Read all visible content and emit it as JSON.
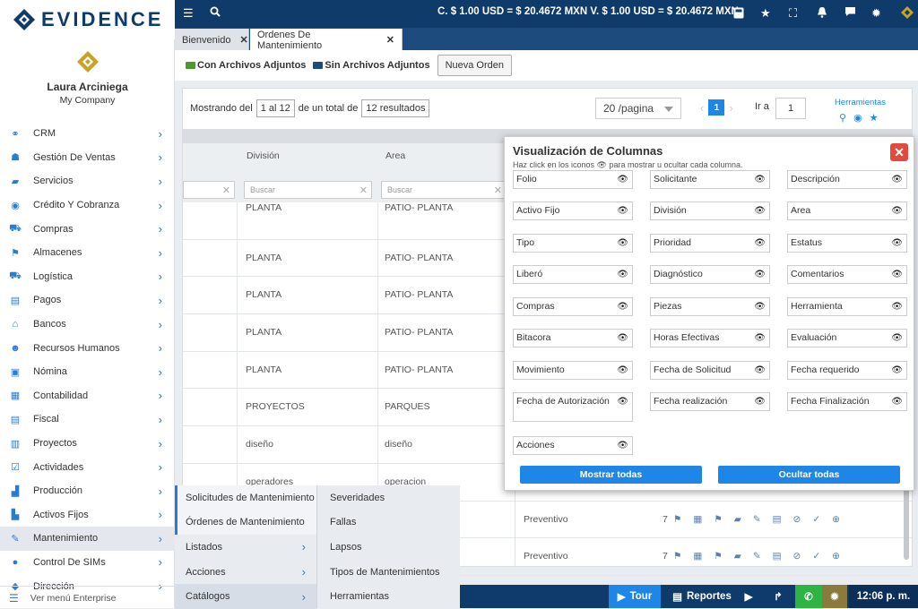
{
  "brand": {
    "name": "EVIDENCE"
  },
  "topbar": {
    "rates": "C. $ 1.00 USD = $ 20.4672 MXN   V. $ 1.00 USD = $ 20.4672 MXN",
    "icons": [
      "menu-icon",
      "search-icon",
      "calculator-icon",
      "star-icon",
      "fullscreen-icon",
      "bell-icon",
      "chat-icon",
      "gear-icon",
      "logo-icon"
    ]
  },
  "user": {
    "name": "Laura Arciniega",
    "company": "My Company"
  },
  "menu": [
    {
      "label": "CRM",
      "icon": "crm-icon",
      "glyph": "⚭"
    },
    {
      "label": "Gestión De Ventas",
      "icon": "sales-icon",
      "glyph": "☗"
    },
    {
      "label": "Servicios",
      "icon": "services-icon",
      "glyph": "▰"
    },
    {
      "label": "Crédito Y Cobranza",
      "icon": "credit-icon",
      "glyph": "◉"
    },
    {
      "label": "Compras",
      "icon": "cart-icon",
      "glyph": "⛟"
    },
    {
      "label": "Almacenes",
      "icon": "warehouse-icon",
      "glyph": "⚑"
    },
    {
      "label": "Logística",
      "icon": "truck-icon",
      "glyph": "⛟"
    },
    {
      "label": "Pagos",
      "icon": "payments-icon",
      "glyph": "▤"
    },
    {
      "label": "Bancos",
      "icon": "bank-icon",
      "glyph": "⌂"
    },
    {
      "label": "Recursos Humanos",
      "icon": "people-icon",
      "glyph": "☻"
    },
    {
      "label": "Nómina",
      "icon": "payroll-icon",
      "glyph": "▣"
    },
    {
      "label": "Contabilidad",
      "icon": "calculator-icon",
      "glyph": "▦"
    },
    {
      "label": "Fiscal",
      "icon": "fiscal-icon",
      "glyph": "▤"
    },
    {
      "label": "Proyectos",
      "icon": "chart-icon",
      "glyph": "▥"
    },
    {
      "label": "Actividades",
      "icon": "check-icon",
      "glyph": "☑"
    },
    {
      "label": "Producción",
      "icon": "production-icon",
      "glyph": "▟"
    },
    {
      "label": "Activos Fijos",
      "icon": "assets-icon",
      "glyph": "▙"
    },
    {
      "label": "Mantenimiento",
      "icon": "wrench-icon",
      "glyph": "✎"
    },
    {
      "label": "Control De SIMs",
      "icon": "location-icon",
      "glyph": "●"
    },
    {
      "label": "Dirección",
      "icon": "direction-icon",
      "glyph": "◆"
    }
  ],
  "enterprise_link": "Ver menú Enterprise",
  "tabs": [
    {
      "label": "Bienvenido"
    },
    {
      "label": "Ordenes De Mantenimiento"
    }
  ],
  "filterbar": {
    "with_attachments": "Con Archivos Adjuntos",
    "without_attachments": "Sin Archivos Adjuntos",
    "new_order": "Nueva Orden",
    "colors": {
      "green_folder": "#4a9a2e",
      "blue_folder": "#1e4b7e"
    }
  },
  "paging": {
    "showing": "Mostrando del",
    "range": "1 al 12",
    "of_total": "de un total de",
    "total": "12 resultados",
    "per_page": "20 /pagina",
    "current_page": "1",
    "go_to": "Ir a",
    "go_value": "1",
    "tools": "Herramientas"
  },
  "table": {
    "headers": [
      "División",
      "Area"
    ],
    "search_placeholder": "Buscar",
    "rows": [
      {
        "division": "PLANTA",
        "area": "PATIO- PLANTA"
      },
      {
        "division": "PLANTA",
        "area": "PATIO- PLANTA"
      },
      {
        "division": "PLANTA",
        "area": "PATIO- PLANTA"
      },
      {
        "division": "PLANTA",
        "area": "PATIO- PLANTA"
      },
      {
        "division": "PLANTA",
        "area": "PATIO- PLANTA"
      },
      {
        "division": "PROYECTOS",
        "area": "PARQUES"
      },
      {
        "division": "diseño",
        "area": "diseño"
      },
      {
        "division": "operadores",
        "area": "operacion"
      }
    ],
    "preventivo_rows": [
      {
        "tipo": "Preventivo",
        "num": "7"
      },
      {
        "tipo": "Preventivo",
        "num": "7"
      }
    ]
  },
  "columns_popup": {
    "title": "Visualización de Columnas",
    "subtitle": "Haz click en los iconos 👁 para mostrar u ocultar cada columna.",
    "columns": [
      "Folio",
      "Solicitante",
      "Descripción",
      "Activo Fijo",
      "División",
      "Area",
      "Tipo",
      "Prioridad",
      "Estatus",
      "Liberó",
      "Diagnóstico",
      "Comentarios",
      "Compras",
      "Piezas",
      "Herramienta",
      "Bitacora",
      "Horas Efectivas",
      "Evaluación",
      "Movimiento",
      "Fecha de Solicitud",
      "Fecha requerido",
      "Fecha de Autorización",
      "Fecha realización",
      "Fecha Finalización",
      "Acciones"
    ],
    "show_all": "Mostrar todas",
    "hide_all": "Ocultar todas",
    "accent": "#1e86e6",
    "close_color": "#e24a3b"
  },
  "submenu": {
    "items": [
      {
        "label": "Solicitudes de Mantenimiento",
        "arrow": false
      },
      {
        "label": "Órdenes de Mantenimiento",
        "arrow": false
      },
      {
        "label": "Listados",
        "arrow": true
      },
      {
        "label": "Acciones",
        "arrow": true
      },
      {
        "label": "Catálogos",
        "arrow": true
      }
    ],
    "catalogs": [
      "Severidades",
      "Fallas",
      "Lapsos",
      "Tipos de Mantenimientos",
      "Herramientas"
    ]
  },
  "bottombar": {
    "tour": "Tour",
    "reports": "Reportes",
    "time": "12:06 p. m.",
    "colors": {
      "tour": "#1e86e6",
      "whatsapp": "#2fb344",
      "settings": "#8a7a3e"
    }
  }
}
